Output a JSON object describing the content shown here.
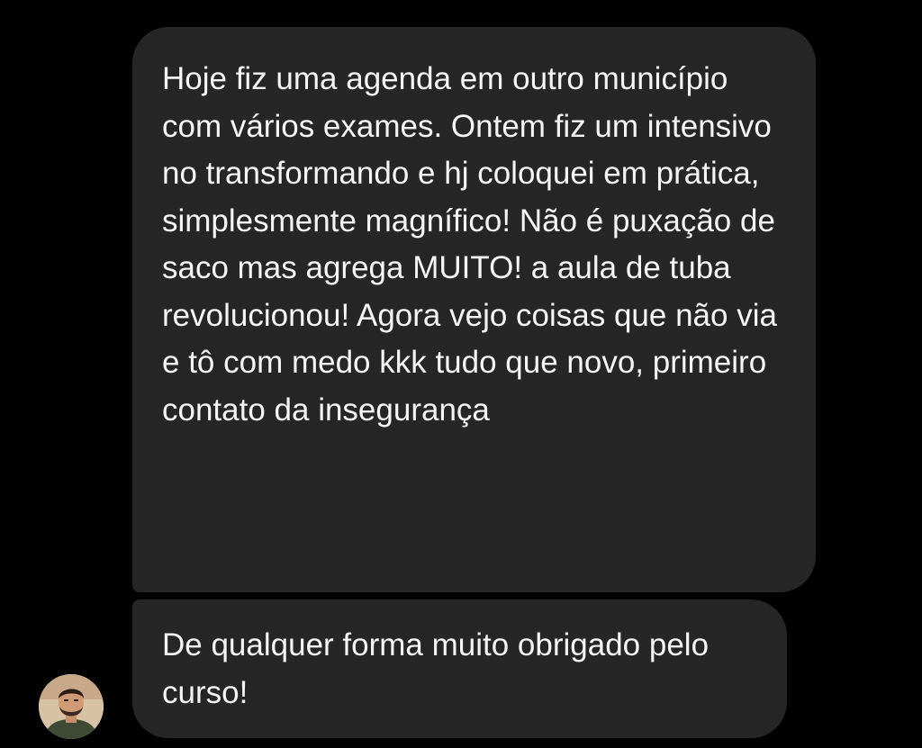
{
  "conversation": {
    "messages": [
      {
        "sender": "contact",
        "text": "Hoje fiz uma agenda em outro município com vários exames. Ontem fiz um intensivo no transformando e hj coloquei em prática, simplesmente magnífico! Não é puxação de saco mas agrega MUITO! a aula de tuba revolucionou! Agora vejo coisas que não via e tô com medo kkk tudo que novo, primeiro contato da insegurança"
      },
      {
        "sender": "contact",
        "text": "De qualquer forma muito obrigado pelo curso!"
      }
    ],
    "contact_avatar_icon": "user-avatar-photo"
  },
  "colors": {
    "background": "#000000",
    "bubble": "#262626",
    "text": "#f5f5f5"
  }
}
